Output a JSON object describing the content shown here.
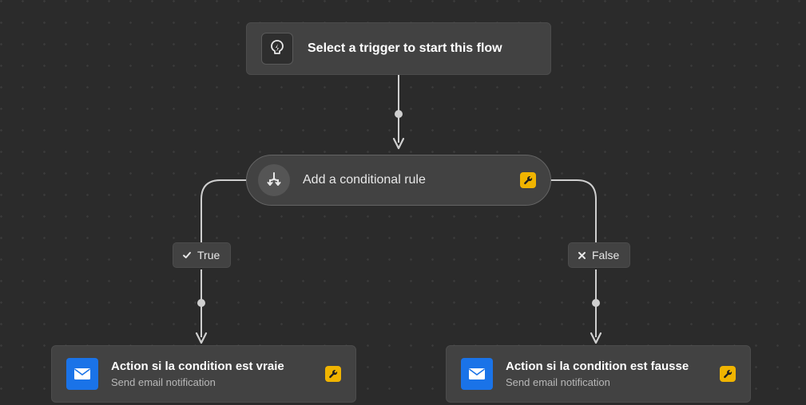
{
  "trigger": {
    "label": "Select a trigger to start this flow"
  },
  "condition": {
    "label": "Add a conditional rule"
  },
  "branches": {
    "true_label": "True",
    "false_label": "False"
  },
  "action_true": {
    "title": "Action si la condition est vraie",
    "subtitle": "Send email notification"
  },
  "action_false": {
    "title": "Action si la condition est fausse",
    "subtitle": "Send email notification"
  },
  "colors": {
    "bg": "#2b2b2b",
    "node": "#424242",
    "warn": "#f0b400",
    "action_icon": "#1a73e8"
  }
}
